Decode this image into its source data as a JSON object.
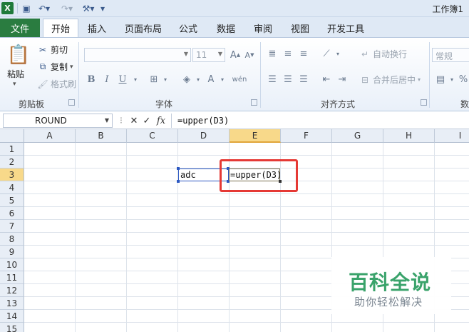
{
  "window": {
    "title": "工作簿1"
  },
  "quick_access": {
    "save_icon": "save-icon",
    "undo_icon": "undo-icon",
    "redo_icon": "redo-icon",
    "tools_icon": "tools-icon"
  },
  "tabs": [
    {
      "label": "文件"
    },
    {
      "label": "开始"
    },
    {
      "label": "插入"
    },
    {
      "label": "页面布局"
    },
    {
      "label": "公式"
    },
    {
      "label": "数据"
    },
    {
      "label": "审阅"
    },
    {
      "label": "视图"
    },
    {
      "label": "开发工具"
    }
  ],
  "ribbon": {
    "clipboard": {
      "paste": "粘贴",
      "cut": "剪切",
      "copy": "复制",
      "format_painter": "格式刷",
      "label": "剪贴板"
    },
    "font": {
      "font_name": "",
      "font_size": "11",
      "bold": "B",
      "italic": "I",
      "underline": "U",
      "label": "字体"
    },
    "alignment": {
      "wrap_text": "自动换行",
      "merge_center": "合并后居中",
      "label": "对齐方式"
    },
    "number": {
      "format": "常规",
      "percent": "%",
      "label_partial": "数"
    }
  },
  "formula_bar": {
    "name_box": "ROUND",
    "cancel_symbol": "✕",
    "enter_symbol": "✓",
    "fx_label": "fx",
    "formula": "=upper(D3)"
  },
  "grid": {
    "columns": [
      "A",
      "B",
      "C",
      "D",
      "E",
      "F",
      "G",
      "H",
      "I"
    ],
    "active_column": "E",
    "rows": [
      "1",
      "2",
      "3",
      "4",
      "5",
      "6",
      "7",
      "8",
      "9",
      "10",
      "11",
      "12",
      "13",
      "14",
      "15"
    ],
    "active_row": "3",
    "cells": {
      "D3": "adc",
      "E3": "=upper(D3)"
    }
  },
  "watermark": {
    "title": "百科全说",
    "subtitle": "助你轻松解决"
  },
  "colors": {
    "file_tab": "#2a7c40",
    "highlight_box": "#e53935",
    "watermark_green": "#3aa36b"
  }
}
